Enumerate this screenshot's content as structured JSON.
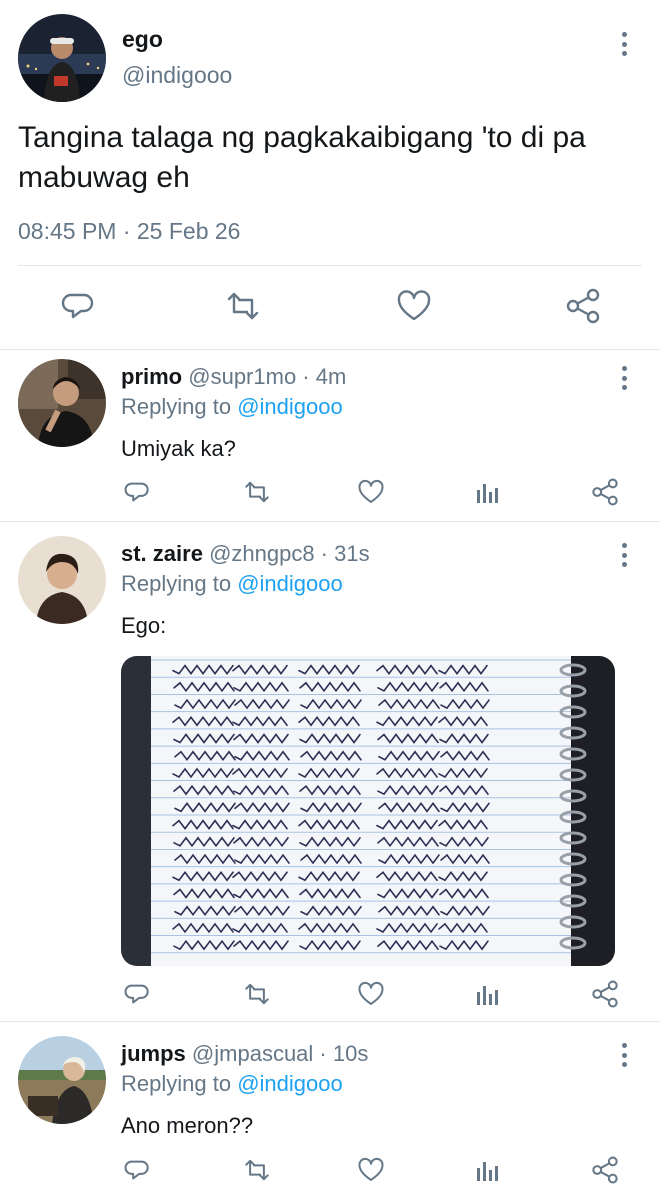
{
  "main_tweet": {
    "author_name": "ego",
    "author_handle": "@indigooo",
    "text": "Tangina talaga ng pagkakaibigang 'to di pa mabuwag eh",
    "timestamp": "08:45 PM · 25 Feb 26",
    "actions": [
      "reply-icon",
      "retweet-icon",
      "like-icon",
      "share-icon"
    ]
  },
  "replies": [
    {
      "name": "primo",
      "meta": "@supr1mo · 4m",
      "replying_prefix": "Replying to ",
      "replying_handle": "@indigooo",
      "text": "Umiyak ka?"
    },
    {
      "name": "st. zaire",
      "meta": "@zhngpc8 · 31s",
      "replying_prefix": "Replying to ",
      "replying_handle": "@indigooo",
      "text": "Ego:",
      "media": {
        "type": "photo",
        "handwritten_rows": 17,
        "row_text": "Sorry Baby Hindi na maoolit 100%"
      }
    },
    {
      "name": "jumps",
      "meta": "@jmpascual · 10s",
      "replying_prefix": "Replying to ",
      "replying_handle": "@indigooo",
      "text": "Ano meron??"
    }
  ],
  "reply_actions": [
    "reply-icon",
    "retweet-icon",
    "like-icon",
    "analytics-icon",
    "share-icon"
  ],
  "colors": {
    "text": "#14171a",
    "muted": "#657786",
    "link": "#1da1f2",
    "divider": "#e1e8ed"
  }
}
